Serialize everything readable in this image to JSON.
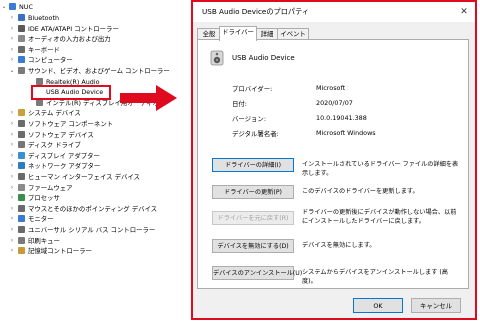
{
  "tree": {
    "root": "NUC",
    "items": [
      {
        "label": "Bluetooth",
        "expanded": false
      },
      {
        "label": "IDE ATA/ATAPI コントローラー",
        "expanded": false
      },
      {
        "label": "オーディオの入力および出力",
        "expanded": false
      },
      {
        "label": "キーボード",
        "expanded": false
      },
      {
        "label": "コンピューター",
        "expanded": false
      },
      {
        "label": "サウンド、ビデオ、およびゲーム コントローラー",
        "expanded": true
      },
      {
        "label": "Realtek(R) Audio",
        "child": true
      },
      {
        "label": "USB Audio Device",
        "child": true,
        "selected": true
      },
      {
        "label": "インテル(R) ディスプレイ用オーディオ",
        "child": true
      },
      {
        "label": "システム デバイス",
        "expanded": false
      },
      {
        "label": "ソフトウェア コンポーネント",
        "expanded": false
      },
      {
        "label": "ソフトウェア デバイス",
        "expanded": false
      },
      {
        "label": "ディスク ドライブ",
        "expanded": false
      },
      {
        "label": "ディスプレイ アダプター",
        "expanded": false
      },
      {
        "label": "ネットワーク アダプター",
        "expanded": false
      },
      {
        "label": "ヒューマン インターフェイス デバイス",
        "expanded": false
      },
      {
        "label": "ファームウェア",
        "expanded": false
      },
      {
        "label": "プロセッサ",
        "expanded": false
      },
      {
        "label": "マウスとそのほかのポインティング デバイス",
        "expanded": false
      },
      {
        "label": "モニター",
        "expanded": false
      },
      {
        "label": "ユニバーサル シリアル バス コントローラー",
        "expanded": false
      },
      {
        "label": "印刷キュー",
        "expanded": false
      },
      {
        "label": "記憶域コントローラー",
        "expanded": false
      }
    ]
  },
  "dialog": {
    "title": "USB Audio Deviceのプロパティ",
    "close": "✕",
    "tabs": [
      "全般",
      "ドライバー",
      "詳細",
      "イベント"
    ],
    "device_name": "USB Audio Device",
    "properties": [
      {
        "key": "プロバイダー:",
        "value": "Microsoft"
      },
      {
        "key": "日付:",
        "value": "2020/07/07"
      },
      {
        "key": "バージョン:",
        "value": "10.0.19041.388"
      },
      {
        "key": "デジタル署名者:",
        "value": "Microsoft Windows"
      }
    ],
    "actions": [
      {
        "button": "ドライバーの詳細(I)",
        "description": "インストールされているドライバー ファイルの詳細を表示します。",
        "enabled": true
      },
      {
        "button": "ドライバーの更新(P)",
        "description": "このデバイスのドライバーを更新します。",
        "enabled": true
      },
      {
        "button": "ドライバーを元に戻す(R)",
        "description": "ドライバーの更新後にデバイスが動作しない場合、以前にインストールしたドライバーに戻します。",
        "enabled": false
      },
      {
        "button": "デバイスを無効にする(D)",
        "description": "デバイスを無効にします。",
        "enabled": true
      },
      {
        "button": "デバイスのアンインストール(U)",
        "description": "システムからデバイスをアンインストールします (高度)。",
        "enabled": true
      }
    ],
    "ok": "OK",
    "cancel": "キャンセル"
  },
  "colors": {
    "highlight": "#e00a1e",
    "accent": "#0078d7"
  }
}
